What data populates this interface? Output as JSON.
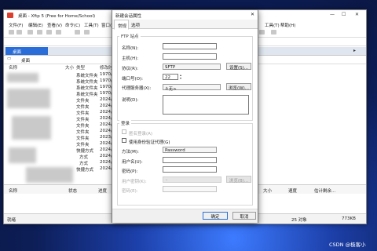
{
  "main_window": {
    "title_short": "桌面",
    "title": "- Xftp 5 (Free for Home/School)",
    "menu": [
      "文件(F)",
      "编辑(E)",
      "查看(V)",
      "命令(C)",
      "工具(T)",
      "窗口(W)",
      "帮助(H)"
    ],
    "tab_label": "桌面",
    "address": "桌面",
    "columns": [
      "名称",
      "大小",
      "类型",
      "修改时间"
    ],
    "rows": [
      {
        "type": "系统文件夹",
        "date": "1970/"
      },
      {
        "type": "系统文件夹",
        "date": "1970/"
      },
      {
        "type": "系统文件夹",
        "date": "1970/"
      },
      {
        "type": "系统文件夹",
        "date": "1970/"
      },
      {
        "type": "文件夹",
        "date": "2024/"
      },
      {
        "type": "文件夹",
        "date": "2024/"
      },
      {
        "type": "文件夹",
        "date": "2024/"
      },
      {
        "type": "文件夹",
        "date": "2024/"
      },
      {
        "type": "文件夹",
        "date": "2024/"
      },
      {
        "type": "文件夹",
        "date": "2024/"
      },
      {
        "type": "文件夹",
        "date": "2023/"
      },
      {
        "type": "文件夹",
        "date": "2024/"
      },
      {
        "type": "快捷方式",
        "date": "2024/"
      },
      {
        "type": "方式",
        "date": "2024/"
      },
      {
        "type": "方式",
        "date": "2024/"
      },
      {
        "type": "快捷方式",
        "date": "2024/"
      }
    ],
    "transfer_columns": [
      "名称",
      "状态",
      "进度",
      "大小",
      "速度",
      "估计剩余..."
    ],
    "status_left": "就绪",
    "status_mid": "25 对象",
    "status_right": "773KB"
  },
  "dialog": {
    "title": "新建会话属性",
    "tabs": [
      "常规",
      "选项"
    ],
    "ftp_section": "FTP 站点",
    "name_label": "名称(N):",
    "host_label": "主机(H):",
    "protocol_label": "协议(R):",
    "protocol_value": "SFTP",
    "settings_button": "设置(S)...",
    "port_label": "端口号(O):",
    "port_value": "22",
    "proxy_label": "代理服务器(X):",
    "proxy_value": "<无>",
    "browse_button": "浏览(W)...",
    "desc_label": "说明(D):",
    "login_section": "登录",
    "anonymous_label": "匿名登录(A)",
    "agent_label": "使用身份验证代理(G)",
    "method_label": "方法(M):",
    "method_value": "Password",
    "user_label": "用户名(U):",
    "password_label": "密码(P):",
    "key_label": "用户密钥(K):",
    "key_browse_button": "浏览(B)...",
    "passphrase_label": "密码(E):",
    "ok_button": "确定",
    "cancel_button": "取消"
  },
  "watermark": "CSDN @极客小"
}
